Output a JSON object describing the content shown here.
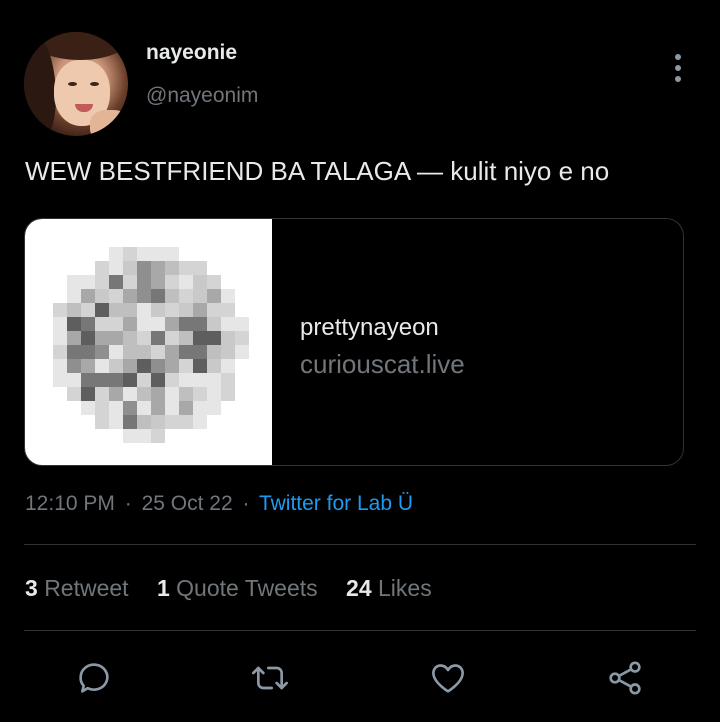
{
  "tweet": {
    "display_name": "nayeonie",
    "handle": "@nayeonim",
    "text": "WEW BESTFRIEND BA TALAGA — kulit niyo e no",
    "card": {
      "title": "prettynayeon",
      "domain": "curiouscat.live"
    },
    "time": "12:10 PM",
    "date": "25 Oct 22",
    "separator": "·",
    "source": "Twitter for Lab Ü"
  },
  "stats": {
    "retweets": {
      "count": "3",
      "label": "Retweet"
    },
    "quotes": {
      "count": "1",
      "label": "Quote Tweets"
    },
    "likes": {
      "count": "24",
      "label": "Likes"
    }
  },
  "icons": {
    "more": "more-vertical-icon",
    "reply": "reply-icon",
    "retweet": "retweet-icon",
    "like": "heart-icon",
    "share": "share-icon"
  },
  "colors": {
    "background": "#000000",
    "text_primary": "#e7e9ea",
    "text_secondary": "#71767b",
    "accent": "#1d9bf0"
  }
}
